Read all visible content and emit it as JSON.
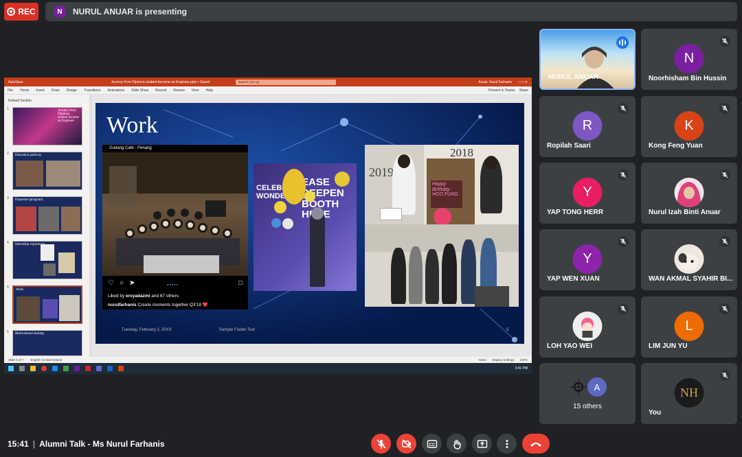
{
  "top_bar": {
    "rec_label": "REC",
    "presenter_initial": "N",
    "presenting_text": "NURUL ANUAR is presenting"
  },
  "shared_screen": {
    "ppt_title_left": "AutoSave",
    "ppt_doc_title": "Journey from Diploma student become an Engineer.pptx • Saved",
    "ppt_search": "Search (Alt+Q)",
    "ppt_user": "Anuar, Nurul Farhanis",
    "ribbon_tabs": [
      "File",
      "Home",
      "Insert",
      "Draw",
      "Design",
      "Transitions",
      "Animations",
      "Slide Show",
      "Record",
      "Review",
      "View",
      "Help"
    ],
    "present_in_teams": "Present in Teams",
    "share": "Share",
    "section_title": "Default Section",
    "thumbnails": [
      {
        "num": "1",
        "title": "Journey from Diploma student become an Engineer"
      },
      {
        "num": "2",
        "title": "Education pathway"
      },
      {
        "num": "3",
        "title": "Exposure (program)"
      },
      {
        "num": "4",
        "title": "Internship experience"
      },
      {
        "num": "5",
        "title": "Work"
      },
      {
        "num": "6",
        "title": "Motivational sharing"
      }
    ],
    "slide": {
      "title": "Work",
      "ig_location": "Gudang Café - Penang",
      "ig_liked_prefix": "Liked by ",
      "ig_liked_user": "ersyadazmi",
      "ig_liked_suffix": " and 67 others",
      "ig_caption_user": "nurulfarhanis",
      "ig_caption_text": " Create moments together Q3'18 ❤️",
      "photo3_year_left": "2019",
      "photo3_year_right": "2018",
      "photo3_sign": "Happy Birthday HOO FUNG",
      "photo2_banner": "CELEBRATE WONDERFUL",
      "photo2_banner2": "EASE DEEPEN BOOTH HERE",
      "footer_date": "Tuesday, February 2, 20XX",
      "footer_text": "Sample Footer Text",
      "footer_num": "5"
    },
    "status_left": "Slide 5 of 7",
    "status_lang": "English (United States)",
    "status_notes": "Notes",
    "status_display": "Display Settings",
    "status_zoom": "100%",
    "taskbar_time": "3:41 PM"
  },
  "participants": [
    {
      "name": "NURUL ANUAR",
      "type": "video",
      "speaking": true
    },
    {
      "name": "Noorhisham Bin Hussin",
      "initial": "N",
      "color": "#7b1fa2",
      "muted": true
    },
    {
      "name": "Ropilah Saari",
      "initial": "R",
      "color": "#7e57c2",
      "muted": true
    },
    {
      "name": "Kong Feng Yuan",
      "initial": "K",
      "color": "#d84315",
      "muted": true
    },
    {
      "name": "YAP TONG HERR",
      "initial": "Y",
      "color": "#e91e63",
      "muted": true
    },
    {
      "name": "Nurul Izah Binti Anuar",
      "type": "photo",
      "muted": true
    },
    {
      "name": "YAP WEN XUAN",
      "initial": "Y",
      "color": "#8e24aa",
      "muted": true
    },
    {
      "name": "WAN AKMAL SYAHIR BI...",
      "type": "photo",
      "muted": true
    },
    {
      "name": "LOH YAO WEI",
      "type": "photo",
      "muted": true
    },
    {
      "name": "LIM JUN YU",
      "initial": "L",
      "color": "#ef6c00",
      "muted": true
    },
    {
      "name": "15 others",
      "initial": "A",
      "color": "#5c6bc0"
    },
    {
      "name": "You",
      "initial": "NH",
      "color": "#1b1b1b",
      "muted": true
    }
  ],
  "bottom_bar": {
    "time": "15:41",
    "separator": "|",
    "meeting_name": "Alumni Talk - Ms Nurul Farhanis"
  },
  "colors": {
    "background": "#202124",
    "tile": "#3c4043",
    "danger": "#ea4335",
    "accent": "#1a73e8"
  }
}
